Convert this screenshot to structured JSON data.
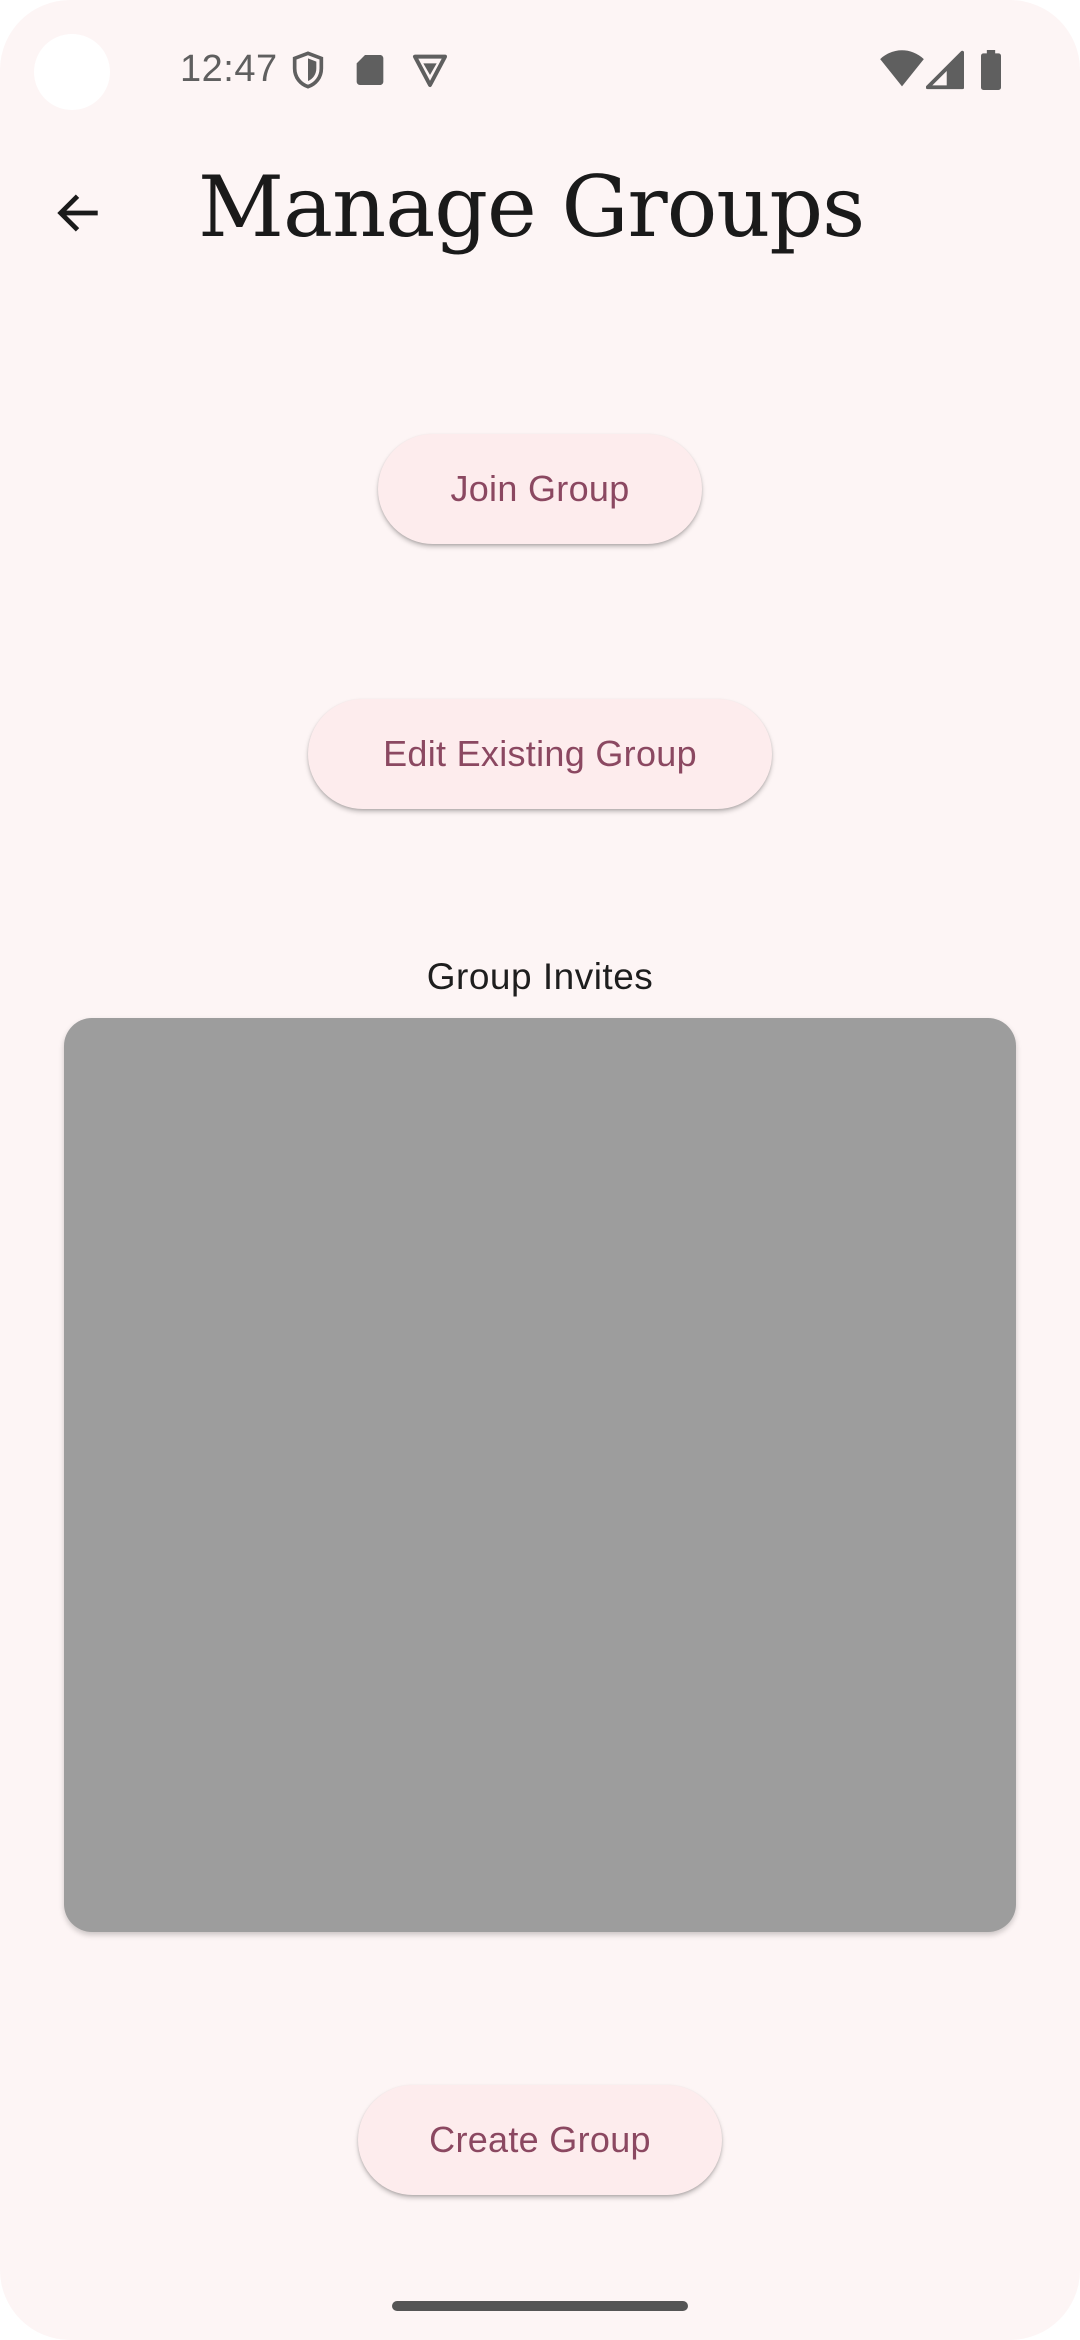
{
  "status_bar": {
    "time": "12:47",
    "icons": [
      "shield-icon",
      "sd-card-icon",
      "vpn-badge-icon",
      "wifi-icon",
      "signal-icon",
      "battery-icon"
    ]
  },
  "app_bar": {
    "back_icon": "arrow-back-icon",
    "title": "Manage Groups"
  },
  "actions": {
    "join_label": "Join Group",
    "edit_label": "Edit Existing Group",
    "create_label": "Create Group"
  },
  "invites": {
    "label": "Group Invites"
  },
  "colors": {
    "background": "#fdf5f5",
    "button_bg": "#fdeced",
    "button_text": "#8b4861",
    "panel": "#9d9d9d"
  }
}
